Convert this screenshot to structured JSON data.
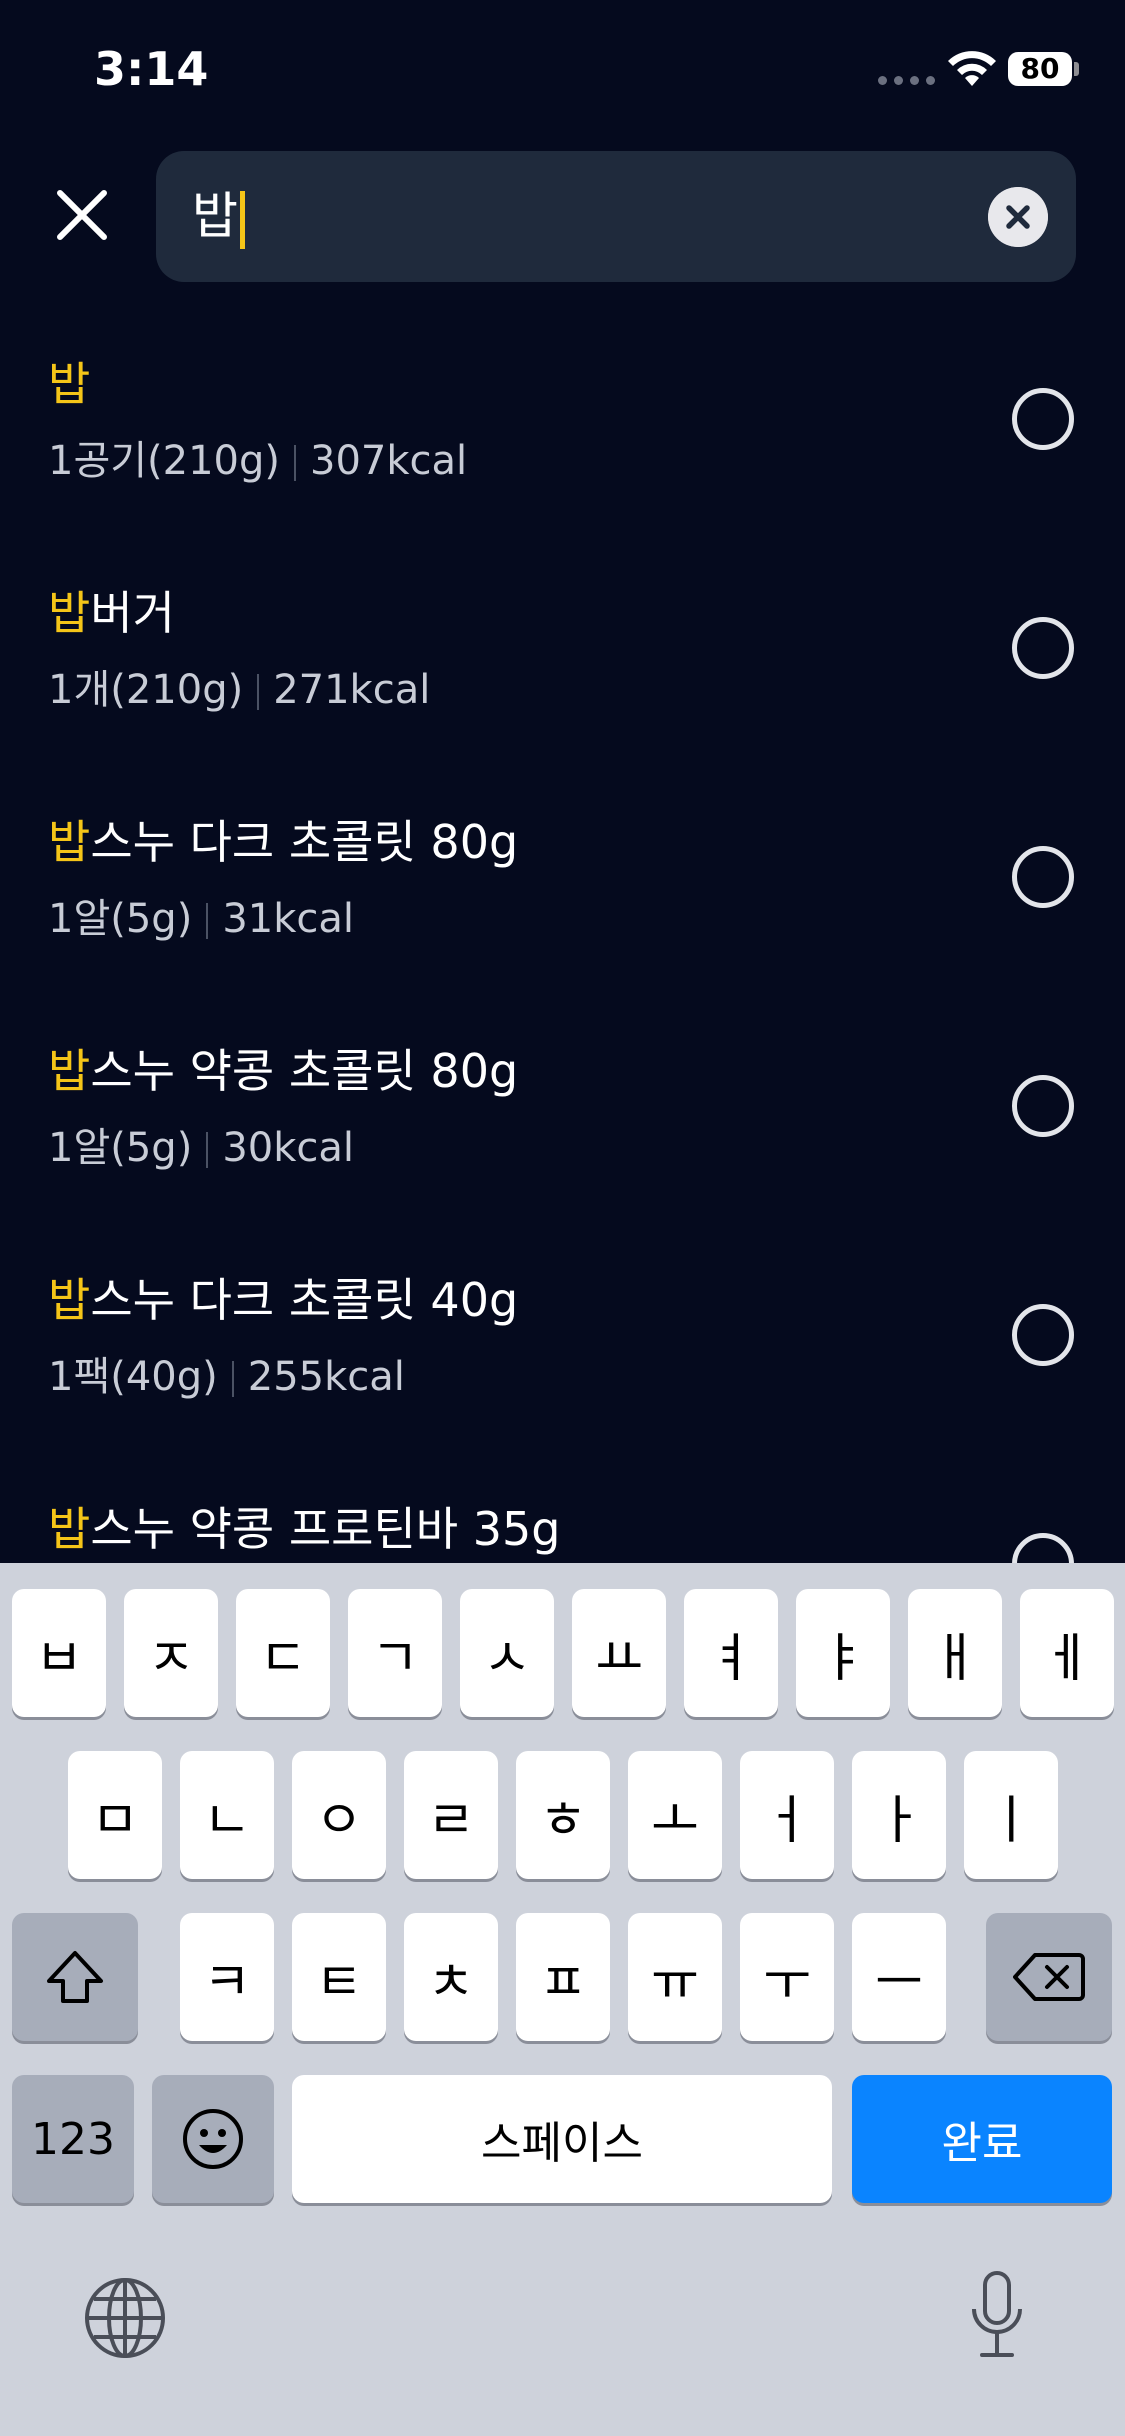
{
  "status": {
    "time": "3:14",
    "battery": "80"
  },
  "search": {
    "value": "밥"
  },
  "results": [
    {
      "highlight": "밥",
      "rest": "",
      "serving": "1공기(210g)",
      "kcal": "307kcal"
    },
    {
      "highlight": "밥",
      "rest": "버거",
      "serving": "1개(210g)",
      "kcal": "271kcal"
    },
    {
      "highlight": "밥",
      "rest": "스누 다크 초콜릿 80g",
      "serving": "1알(5g)",
      "kcal": "31kcal"
    },
    {
      "highlight": "밥",
      "rest": "스누 약콩 초콜릿 80g",
      "serving": "1알(5g)",
      "kcal": "30kcal"
    },
    {
      "highlight": "밥",
      "rest": "스누 다크 초콜릿 40g",
      "serving": "1팩(40g)",
      "kcal": "255kcal"
    },
    {
      "highlight": "밥",
      "rest": "스누 약콩 프로틴바 35g",
      "serving": "",
      "kcal": ""
    }
  ],
  "keyboard": {
    "row1": [
      "ㅂ",
      "ㅈ",
      "ㄷ",
      "ㄱ",
      "ㅅ",
      "ㅛ",
      "ㅕ",
      "ㅑ",
      "ㅐ",
      "ㅔ"
    ],
    "row2": [
      "ㅁ",
      "ㄴ",
      "ㅇ",
      "ㄹ",
      "ㅎ",
      "ㅗ",
      "ㅓ",
      "ㅏ",
      "ㅣ"
    ],
    "row3": [
      "ㅋ",
      "ㅌ",
      "ㅊ",
      "ㅍ",
      "ㅠ",
      "ㅜ",
      "ㅡ"
    ],
    "numbers": "123",
    "space": "스페이스",
    "done": "완료"
  },
  "colors": {
    "background": "#050a1e",
    "highlight": "#f5c518",
    "accent": "#0a84ff"
  },
  "icons": [
    "close-icon",
    "clear-search-icon",
    "radio-unchecked-icon",
    "shift-icon",
    "backspace-icon",
    "emoji-icon",
    "globe-icon",
    "microphone-icon",
    "wifi-icon"
  ]
}
